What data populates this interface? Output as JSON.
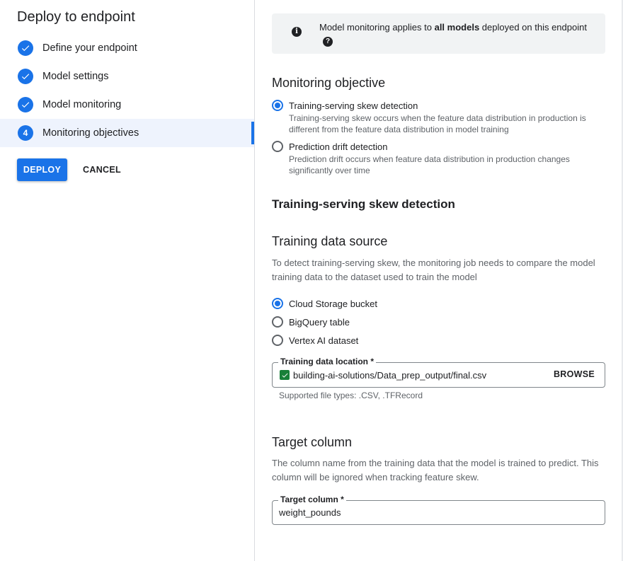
{
  "left": {
    "title": "Deploy to endpoint",
    "steps": [
      {
        "label": "Define your endpoint",
        "state": "done",
        "icon": "check-icon"
      },
      {
        "label": "Model settings",
        "state": "done",
        "icon": "check-icon"
      },
      {
        "label": "Model monitoring",
        "state": "done",
        "icon": "check-icon"
      },
      {
        "label": "Monitoring objectives",
        "state": "active",
        "number": "4"
      }
    ],
    "deploy_label": "DEPLOY",
    "cancel_label": "CANCEL"
  },
  "banner": {
    "info_icon": "i",
    "text_before": "Model monitoring applies to ",
    "text_bold": "all models",
    "text_after": " deployed on this endpoint",
    "help_icon": "?"
  },
  "objective": {
    "heading": "Monitoring objective",
    "options": [
      {
        "label": "Training-serving skew detection",
        "description": "Training-serving skew occurs when the feature data distribution in production is different from the feature data distribution in model training",
        "checked": true
      },
      {
        "label": "Prediction drift detection",
        "description": "Prediction drift occurs when feature data distribution in production changes significantly over time",
        "checked": false
      }
    ]
  },
  "skew": {
    "heading": "Training-serving skew detection"
  },
  "source": {
    "heading": "Training data source",
    "description": "To detect training-serving skew, the monitoring job needs to compare the model training data to the dataset used to train the model",
    "options": [
      {
        "label": "Cloud Storage bucket",
        "checked": true
      },
      {
        "label": "BigQuery table",
        "checked": false
      },
      {
        "label": "Vertex AI dataset",
        "checked": false
      }
    ],
    "location_label": "Training data location *",
    "location_value": "building-ai-solutions/Data_prep_output/final.csv",
    "browse_label": "BROWSE",
    "hint": "Supported file types: .CSV, .TFRecord"
  },
  "target": {
    "heading": "Target column",
    "description": "The column name from the training data that the model is trained to predict. This column will be ignored when tracking feature skew.",
    "field_label": "Target column *",
    "field_value": "weight_pounds"
  },
  "colors": {
    "accent": "#1a73e8",
    "checkbox": "#188038",
    "active_step_bg": "#eef3fd"
  }
}
